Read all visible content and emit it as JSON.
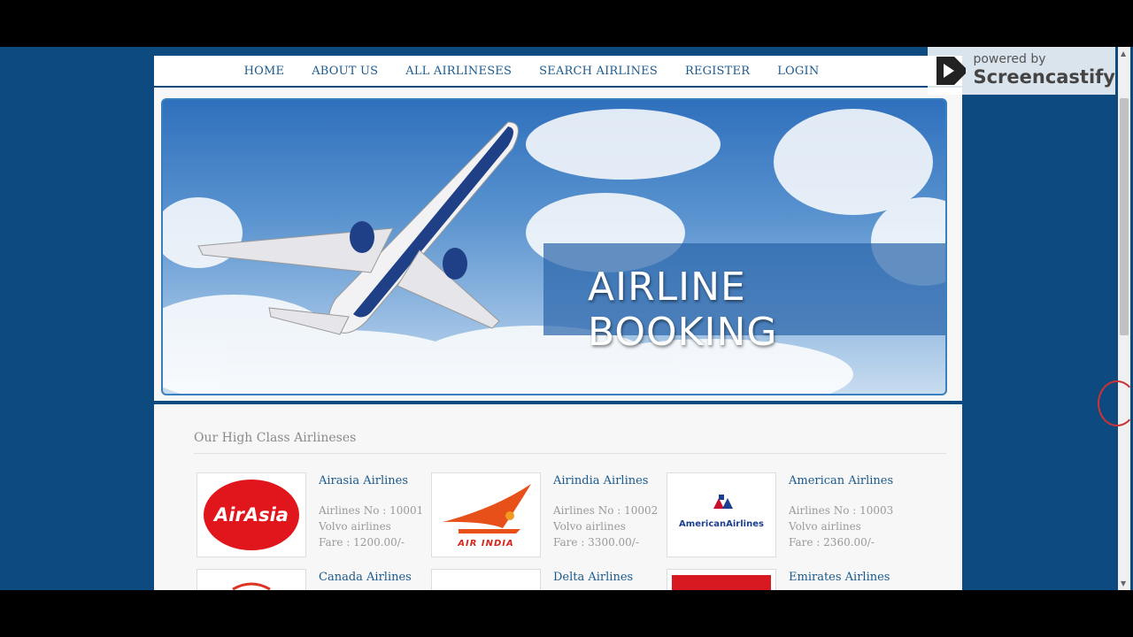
{
  "nav": {
    "home": "HOME",
    "about": "ABOUT US",
    "all_airlines": "ALL AIRLINESES",
    "search": "SEARCH AIRLINES",
    "register": "REGISTER",
    "login": "LOGIN"
  },
  "hero": {
    "title": "AIRLINE BOOKING"
  },
  "section": {
    "title": "Our High Class Airlineses"
  },
  "airlines": [
    {
      "name": "Airasia Airlines",
      "number": "Airlines No : 10001",
      "type": "Volvo airlines",
      "fare": "Fare : 1200.00/-",
      "logo_text": "AirAsia"
    },
    {
      "name": "Airindia Airlines",
      "number": "Airlines No : 10002",
      "type": "Volvo airlines",
      "fare": "Fare : 3300.00/-",
      "logo_text": "AIR INDIA"
    },
    {
      "name": "American Airlines",
      "number": "Airlines No : 10003",
      "type": "Volvo airlines",
      "fare": "Fare : 2360.00/-",
      "logo_text": "AmericanAirlines"
    },
    {
      "name": "Canada Airlines"
    },
    {
      "name": "Delta Airlines"
    },
    {
      "name": "Emirates Airlines"
    }
  ],
  "watermark": {
    "line1": "powered by",
    "line2": "Screencastify"
  },
  "colors": {
    "page_bg": "#0d4a80",
    "link": "#1b5a8e",
    "airasia_red": "#e1161c",
    "airindia_orange": "#e8501a"
  }
}
